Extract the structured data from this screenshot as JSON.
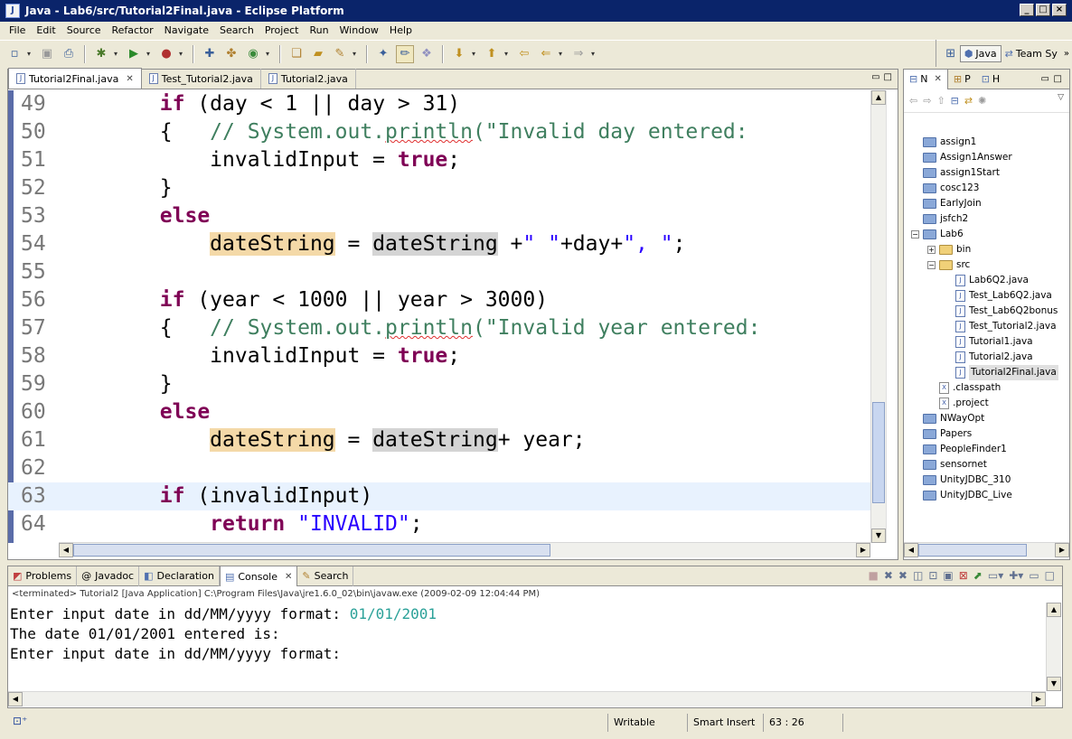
{
  "window": {
    "title": "Java - Lab6/src/Tutorial2Final.java - Eclipse Platform",
    "minimize": "_",
    "maximize": "□",
    "close": "×"
  },
  "menu": [
    "File",
    "Edit",
    "Source",
    "Refactor",
    "Navigate",
    "Search",
    "Project",
    "Run",
    "Window",
    "Help"
  ],
  "perspectives": [
    {
      "label": "Java",
      "active": true
    },
    {
      "label": "Team Sy",
      "active": false
    }
  ],
  "editor": {
    "tabs": [
      {
        "label": "Tutorial2Final.java",
        "active": true
      },
      {
        "label": "Test_Tutorial2.java",
        "active": false
      },
      {
        "label": "Tutorial2.java",
        "active": false
      }
    ],
    "lines": [
      {
        "num": "49",
        "segments": [
          {
            "t": "        "
          },
          {
            "t": "if",
            "c": "kw"
          },
          {
            "t": " (day < 1 || day > 31)"
          }
        ]
      },
      {
        "num": "50",
        "segments": [
          {
            "t": "        {   "
          },
          {
            "t": "// System.out.",
            "c": "cm"
          },
          {
            "t": "println",
            "c": "cm sq"
          },
          {
            "t": "(\"Invalid day entered:",
            "c": "cm"
          }
        ]
      },
      {
        "num": "51",
        "segments": [
          {
            "t": "            invalidInput = "
          },
          {
            "t": "true",
            "c": "kw"
          },
          {
            "t": ";"
          }
        ]
      },
      {
        "num": "52",
        "segments": [
          {
            "t": "        }"
          }
        ]
      },
      {
        "num": "53",
        "segments": [
          {
            "t": "        "
          },
          {
            "t": "else",
            "c": "kw"
          }
        ]
      },
      {
        "num": "54",
        "segments": [
          {
            "t": "            "
          },
          {
            "t": "dateString",
            "c": "occ"
          },
          {
            "t": " = "
          },
          {
            "t": "dateString",
            "c": "occ2"
          },
          {
            "t": " +"
          },
          {
            "t": "\" \"",
            "c": "str"
          },
          {
            "t": "+day+"
          },
          {
            "t": "\", \"",
            "c": "str"
          },
          {
            "t": ";"
          }
        ]
      },
      {
        "num": "55",
        "segments": []
      },
      {
        "num": "56",
        "segments": [
          {
            "t": "        "
          },
          {
            "t": "if",
            "c": "kw"
          },
          {
            "t": " (year < 1000 || year > 3000)"
          }
        ]
      },
      {
        "num": "57",
        "segments": [
          {
            "t": "        {   "
          },
          {
            "t": "// System.out.",
            "c": "cm"
          },
          {
            "t": "println",
            "c": "cm sq"
          },
          {
            "t": "(\"Invalid year entered:",
            "c": "cm"
          }
        ]
      },
      {
        "num": "58",
        "segments": [
          {
            "t": "            invalidInput = "
          },
          {
            "t": "true",
            "c": "kw"
          },
          {
            "t": ";"
          }
        ]
      },
      {
        "num": "59",
        "segments": [
          {
            "t": "        }"
          }
        ]
      },
      {
        "num": "60",
        "segments": [
          {
            "t": "        "
          },
          {
            "t": "else",
            "c": "kw"
          }
        ]
      },
      {
        "num": "61",
        "segments": [
          {
            "t": "            "
          },
          {
            "t": "dateString",
            "c": "occ"
          },
          {
            "t": " = "
          },
          {
            "t": "dateString",
            "c": "occ2"
          },
          {
            "t": "+ year;"
          }
        ]
      },
      {
        "num": "62",
        "segments": []
      },
      {
        "num": "63",
        "current": true,
        "segments": [
          {
            "t": "        "
          },
          {
            "t": "if",
            "c": "kw"
          },
          {
            "t": " (invalidInput)"
          }
        ]
      },
      {
        "num": "64",
        "segments": [
          {
            "t": "            "
          },
          {
            "t": "return",
            "c": "kw"
          },
          {
            "t": " "
          },
          {
            "t": "\"INVALID\"",
            "c": "str"
          },
          {
            "t": ";"
          }
        ]
      }
    ]
  },
  "navigator": {
    "tabs": [
      {
        "label": "N",
        "active": true
      },
      {
        "label": "P",
        "active": false
      },
      {
        "label": "H",
        "active": false
      }
    ],
    "tree": [
      {
        "label": "assign1",
        "level": 0,
        "icon": "project"
      },
      {
        "label": "Assign1Answer",
        "level": 0,
        "icon": "project"
      },
      {
        "label": "assign1Start",
        "level": 0,
        "icon": "project"
      },
      {
        "label": "cosc123",
        "level": 0,
        "icon": "project"
      },
      {
        "label": "EarlyJoin",
        "level": 0,
        "icon": "project"
      },
      {
        "label": "jsfch2",
        "level": 0,
        "icon": "project"
      },
      {
        "label": "Lab6",
        "level": 0,
        "icon": "project",
        "expander": "−"
      },
      {
        "label": "bin",
        "level": 1,
        "icon": "folder",
        "expander": "+"
      },
      {
        "label": "src",
        "level": 1,
        "icon": "folder",
        "expander": "−"
      },
      {
        "label": "Lab6Q2.java",
        "level": 2,
        "icon": "java"
      },
      {
        "label": "Test_Lab6Q2.java",
        "level": 2,
        "icon": "java"
      },
      {
        "label": "Test_Lab6Q2bonus",
        "level": 2,
        "icon": "java"
      },
      {
        "label": "Test_Tutorial2.java",
        "level": 2,
        "icon": "java"
      },
      {
        "label": "Tutorial1.java",
        "level": 2,
        "icon": "java"
      },
      {
        "label": "Tutorial2.java",
        "level": 2,
        "icon": "java"
      },
      {
        "label": "Tutorial2Final.java",
        "level": 2,
        "icon": "java",
        "selected": true
      },
      {
        "label": ".classpath",
        "level": 1,
        "icon": "xml"
      },
      {
        "label": ".project",
        "level": 1,
        "icon": "xml"
      },
      {
        "label": "NWayOpt",
        "level": 0,
        "icon": "project"
      },
      {
        "label": "Papers",
        "level": 0,
        "icon": "project"
      },
      {
        "label": "PeopleFinder1",
        "level": 0,
        "icon": "project"
      },
      {
        "label": "sensornet",
        "level": 0,
        "icon": "project"
      },
      {
        "label": "UnityJDBC_310",
        "level": 0,
        "icon": "project"
      },
      {
        "label": "UnityJDBC_Live",
        "level": 0,
        "icon": "project"
      }
    ]
  },
  "console": {
    "tabs": [
      {
        "label": "Problems",
        "active": false
      },
      {
        "label": "Javadoc",
        "active": false
      },
      {
        "label": "Declaration",
        "active": false
      },
      {
        "label": "Console",
        "active": true
      },
      {
        "label": "Search",
        "active": false
      }
    ],
    "description": "<terminated> Tutorial2 [Java Application] C:\\Program Files\\Java\\jre1.6.0_02\\bin\\javaw.exe (2009-02-09 12:04:44 PM)",
    "output": [
      {
        "text": "Enter input date in dd/MM/yyyy format: ",
        "input": "01/01/2001"
      },
      {
        "text": "The date 01/01/2001 entered is:",
        "input": ""
      },
      {
        "text": "Enter input date in dd/MM/yyyy format:",
        "input": ""
      }
    ]
  },
  "status": {
    "writable": "Writable",
    "insert_mode": "Smart Insert",
    "position": "63 : 26"
  },
  "colors": {
    "keyword": "#7F0055",
    "comment": "#3F7F5F",
    "string": "#2A00FF",
    "console_input": "#2AA198",
    "title_bar": "#0A246A"
  }
}
